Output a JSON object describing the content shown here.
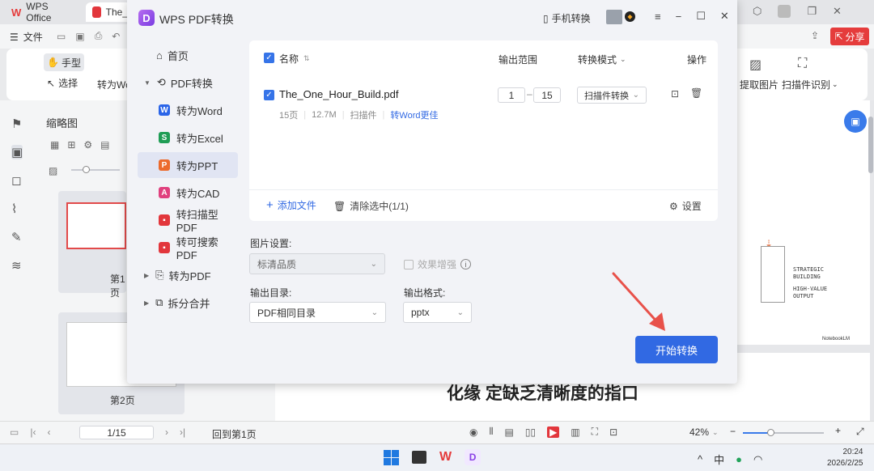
{
  "bg": {
    "tabs": [
      {
        "label": "WPS Office"
      },
      {
        "label": "The_"
      }
    ],
    "menu_file": "文件",
    "share": "分享",
    "ribbon": {
      "hand": "手型",
      "select": "选择",
      "to_word": "转为Wo",
      "extract_image": "提取图片",
      "scan_recognize": "扫描件识别"
    },
    "thumbnail_title": "缩略图",
    "page1_label": "第1页",
    "page2_label": "第2页",
    "doc_heading": "化缘 定缺乏清晰度的指口",
    "doc_diagram": [
      "STRATEGIC",
      "BUILDING",
      "HIGH-VALUE",
      "OUTPUT"
    ],
    "doc_watermark": "NotebookLM",
    "status": {
      "page_value": "1/15",
      "back_first": "回到第1页",
      "zoom": "42%"
    },
    "tray": {
      "ime": "中",
      "time": "20:24",
      "date": "2026/2/25"
    }
  },
  "dialog": {
    "title": "WPS PDF转换",
    "mobile_convert": "手机转换",
    "nav": [
      {
        "label": "首页",
        "icon": "home-icon"
      },
      {
        "label": "PDF转换",
        "icon": "pdf-convert-icon"
      },
      {
        "label": "转为Word",
        "badge": "W",
        "color": "#2b65e8"
      },
      {
        "label": "转为Excel",
        "badge": "S",
        "color": "#1f9d55"
      },
      {
        "label": "转为PPT",
        "badge": "P",
        "color": "#ec6a2c"
      },
      {
        "label": "转为CAD",
        "badge": "A",
        "color": "#e0407e"
      },
      {
        "label": "转扫描型PDF",
        "badge": "▪",
        "color": "#e2363c"
      },
      {
        "label": "转可搜索PDF",
        "badge": "▪",
        "color": "#e2363c"
      },
      {
        "label": "转为PDF",
        "icon": "to-pdf-icon"
      },
      {
        "label": "拆分合并",
        "icon": "split-merge-icon"
      }
    ],
    "table": {
      "col_name": "名称",
      "col_range": "输出范围",
      "col_mode": "转换模式",
      "col_action": "操作",
      "file": {
        "name": "The_One_Hour_Build.pdf",
        "pages": "15页",
        "size": "12.7M",
        "type": "扫描件",
        "tip": "转Word更佳",
        "range_from": "1",
        "range_to": "15",
        "mode": "扫描件转换"
      }
    },
    "add_file": "添加文件",
    "clear_selected": "清除选中(1/1)",
    "settings": "设置",
    "image_settings_label": "图片设置:",
    "image_quality": "标清品质",
    "enhance": "效果增强",
    "output_dir_label": "输出目录:",
    "output_dir": "PDF相同目录",
    "output_format_label": "输出格式:",
    "output_format": "pptx",
    "start": "开始转换"
  }
}
